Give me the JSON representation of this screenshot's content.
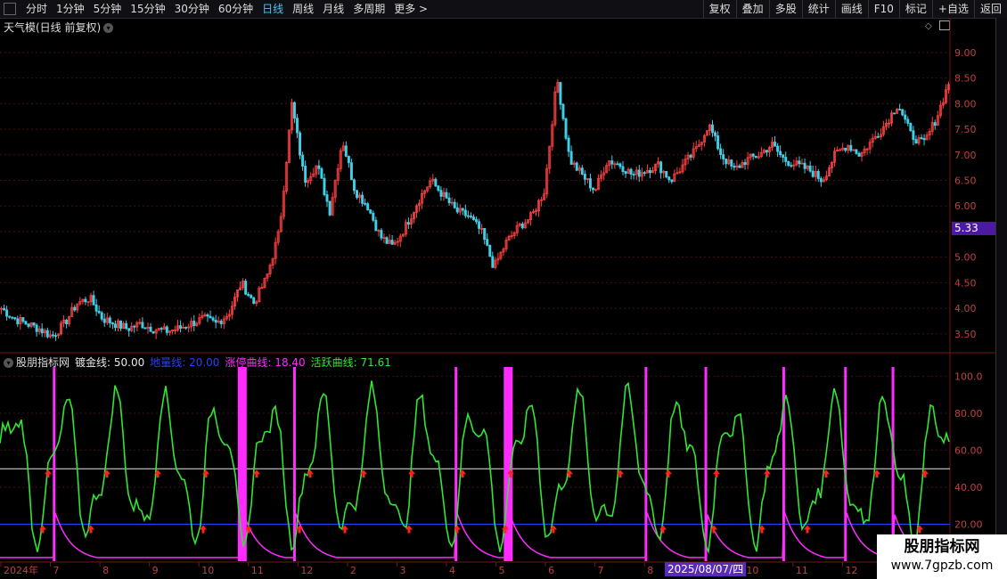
{
  "toolbar": {
    "periods": [
      "分时",
      "1分钟",
      "5分钟",
      "15分钟",
      "30分钟",
      "60分钟",
      "日线",
      "周线",
      "月线",
      "多周期",
      "更多 >"
    ],
    "active_period": "日线",
    "right_buttons": [
      "复权",
      "叠加",
      "多股",
      "统计",
      "画线",
      "F10",
      "标记",
      "+自选",
      "返回"
    ]
  },
  "main_title": "天气模(日线 前复权)",
  "price_tag": "5.33",
  "indicator": {
    "name": "股朋指标网",
    "lines": [
      {
        "label": "镀金线: 50.00",
        "color": "#e6e6e6"
      },
      {
        "label": "地量线: 20.00",
        "color": "#2a3fff"
      },
      {
        "label": "涨停曲线: 18.40",
        "color": "#ff2bff"
      },
      {
        "label": "活跃曲线: 71.61",
        "color": "#31e631"
      }
    ]
  },
  "date_tag": "2025/08/07/四",
  "x_labels": [
    "2024年",
    "7",
    "8",
    "9",
    "10",
    "11",
    "12",
    "2",
    "3",
    "4",
    "5",
    "6",
    "7",
    "8",
    "9",
    "10",
    "11",
    "12",
    "1"
  ],
  "watermark": {
    "line1": "股朋指标网",
    "line2": "www.7gpzb.com"
  },
  "chart_data": [
    {
      "type": "candlestick",
      "title": "天气模(日线 前复权)",
      "ylim": [
        3.2,
        9.4
      ],
      "y_ticks": [
        "9.00",
        "8.50",
        "8.00",
        "7.50",
        "7.00",
        "6.50",
        "6.00",
        "5.50",
        "5.00",
        "4.50",
        "4.00",
        "3.50"
      ],
      "close_path": [
        4.0,
        3.8,
        3.7,
        3.6,
        3.45,
        3.7,
        4.1,
        4.2,
        3.8,
        3.7,
        3.6,
        3.7,
        3.6,
        3.55,
        3.6,
        3.7,
        3.8,
        3.7,
        3.9,
        4.5,
        4.1,
        4.6,
        5.5,
        8.0,
        6.5,
        6.8,
        5.9,
        7.3,
        6.3,
        6.0,
        5.4,
        5.2,
        5.6,
        6.1,
        6.5,
        6.2,
        5.9,
        5.8,
        5.5,
        4.8,
        5.3,
        5.6,
        5.8,
        6.3,
        8.5,
        6.9,
        6.6,
        6.3,
        6.9,
        6.8,
        6.6,
        6.7,
        6.8,
        6.5,
        6.8,
        7.1,
        7.6,
        7.0,
        6.7,
        6.9,
        7.0,
        7.2,
        6.9,
        6.8,
        6.7,
        6.5,
        7.0,
        7.2,
        7.0,
        7.3,
        7.6,
        8.0,
        7.4,
        7.2,
        7.7,
        8.4
      ]
    },
    {
      "type": "line",
      "title": "股朋指标网",
      "ylim": [
        0,
        105
      ],
      "y_ticks": [
        "100.0",
        "80.00",
        "60.00",
        "40.00",
        "20.00"
      ],
      "series": [
        {
          "name": "镀金线",
          "constant": 50
        },
        {
          "name": "地量线",
          "constant": 20
        },
        {
          "name": "涨停曲线",
          "spikes_at_fraction": [
            0.057,
            0.255,
            0.31,
            0.48,
            0.535,
            0.68,
            0.743,
            0.825,
            0.89,
            0.94
          ],
          "last": 18.4
        },
        {
          "name": "活跃曲线",
          "last": 71.61
        }
      ]
    }
  ]
}
